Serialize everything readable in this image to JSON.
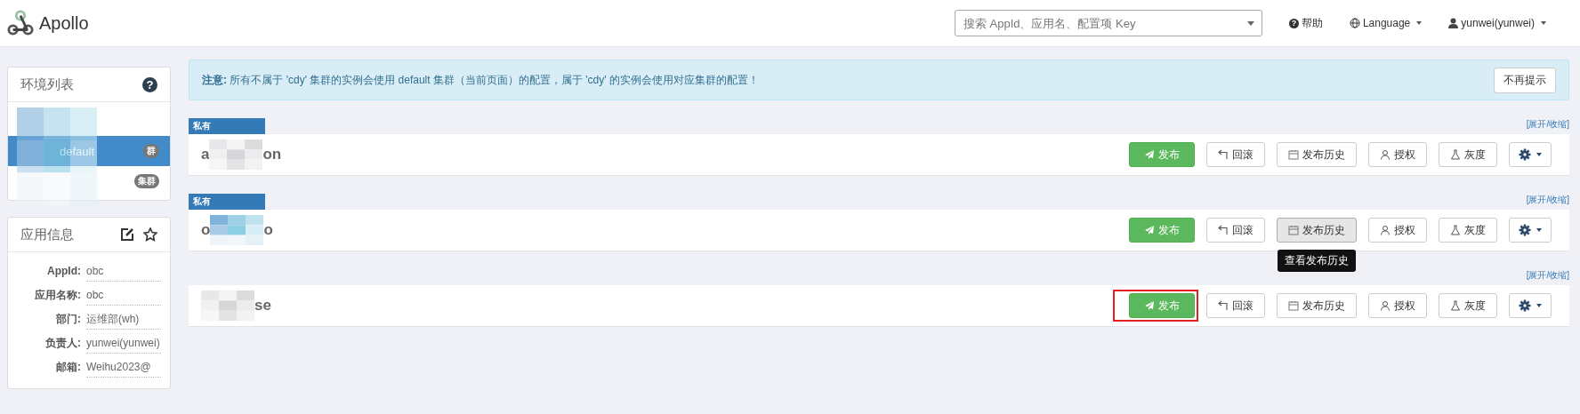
{
  "navbar": {
    "logo": "Apollo",
    "search": {
      "placeholder": "搜索 AppId、应用名、配置项 Key"
    },
    "help_icon": "?",
    "help": "帮助",
    "language": "Language",
    "user": "yunwei(yunwei)"
  },
  "env_panel": {
    "title": "环境列表",
    "help_icon": "?",
    "items": [
      {
        "selected": false
      },
      {
        "label": "default",
        "badge": "群",
        "selected": true
      },
      {
        "badge": "集群",
        "selected": false
      }
    ]
  },
  "app_info": {
    "title": "应用信息",
    "rows": [
      {
        "label": "AppId:",
        "value": "obc"
      },
      {
        "label": "应用名称:",
        "value": "obc"
      },
      {
        "label": "部门:",
        "value": "运维部(wh)"
      },
      {
        "label": "负责人:",
        "value": "yunwei(yunwei)"
      },
      {
        "label": "邮箱:",
        "value": "Weihu2023@"
      }
    ]
  },
  "notice": {
    "text": "**注意:** 所有不属于 'cdy' 集群的实例会使用 default 集群（当前页面）的配置，属于 'cdy' 的实例会使用对应集群的配置！",
    "dismiss": "不再提示"
  },
  "namespaces": [
    {
      "tag": "私有",
      "name_start": "a",
      "name_end": "on",
      "toggle": "[展开/收缩]",
      "buttons": [
        {
          "kind": "publish",
          "label": "发布",
          "hovered": false,
          "marked": false
        },
        {
          "kind": "rollback",
          "label": "回滚",
          "hovered": false,
          "marked": false
        },
        {
          "kind": "history",
          "label": "发布历史",
          "hovered": false,
          "marked": false
        },
        {
          "kind": "grant",
          "label": "授权",
          "hovered": false,
          "marked": false
        },
        {
          "kind": "canary",
          "label": "灰度",
          "hovered": false,
          "marked": false
        },
        {
          "kind": "settings",
          "hovered": false,
          "marked": false
        }
      ]
    },
    {
      "tag": "私有",
      "name_start": "o",
      "name_end": "o",
      "toggle": "[展开/收缩]",
      "tooltip": "查看发布历史",
      "buttons": [
        {
          "kind": "publish",
          "label": "发布",
          "hovered": false,
          "marked": false
        },
        {
          "kind": "rollback",
          "label": "回滚",
          "hovered": false,
          "marked": false
        },
        {
          "kind": "history",
          "label": "发布历史",
          "hovered": true,
          "marked": false
        },
        {
          "kind": "grant",
          "label": "授权",
          "hovered": false,
          "marked": false
        },
        {
          "kind": "canary",
          "label": "灰度",
          "hovered": false,
          "marked": false
        },
        {
          "kind": "settings",
          "hovered": false,
          "marked": false
        }
      ]
    },
    {
      "name_end": "se",
      "toggle": "[展开/收缩]",
      "buttons": [
        {
          "kind": "publish",
          "label": "发布",
          "hovered": false,
          "marked": true
        },
        {
          "kind": "rollback",
          "label": "回滚",
          "hovered": false,
          "marked": false
        },
        {
          "kind": "history",
          "label": "发布历史",
          "hovered": false,
          "marked": false
        },
        {
          "kind": "grant",
          "label": "授权",
          "hovered": false,
          "marked": false
        },
        {
          "kind": "canary",
          "label": "灰度",
          "hovered": false,
          "marked": false
        },
        {
          "kind": "settings",
          "hovered": false,
          "marked": false
        }
      ]
    }
  ]
}
